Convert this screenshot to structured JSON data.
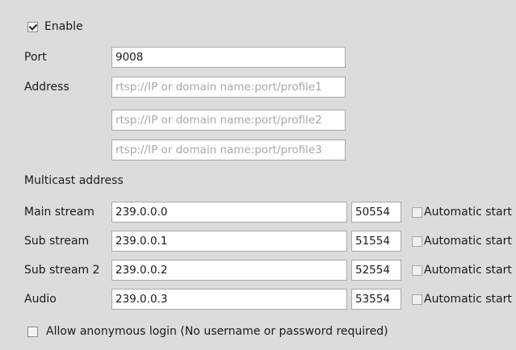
{
  "enable": {
    "label": "Enable",
    "checked": true
  },
  "port": {
    "label": "Port",
    "value": "9008"
  },
  "address": {
    "label": "Address",
    "placeholders": [
      "rtsp://IP or domain name:port/profile1",
      "rtsp://IP or domain name:port/profile2",
      "rtsp://IP or domain name:port/profile3"
    ]
  },
  "multicast": {
    "heading": "Multicast address",
    "automatic_label": "Automatic start",
    "rows": [
      {
        "label": "Main stream",
        "address": "239.0.0.0",
        "port": "50554",
        "automatic": false
      },
      {
        "label": "Sub stream",
        "address": "239.0.0.1",
        "port": "51554",
        "automatic": false
      },
      {
        "label": "Sub stream 2",
        "address": "239.0.0.2",
        "port": "52554",
        "automatic": false
      },
      {
        "label": "Audio",
        "address": "239.0.0.3",
        "port": "53554",
        "automatic": false
      }
    ]
  },
  "anonymous": {
    "label": "Allow anonymous login (No username or password required)",
    "checked": false
  }
}
